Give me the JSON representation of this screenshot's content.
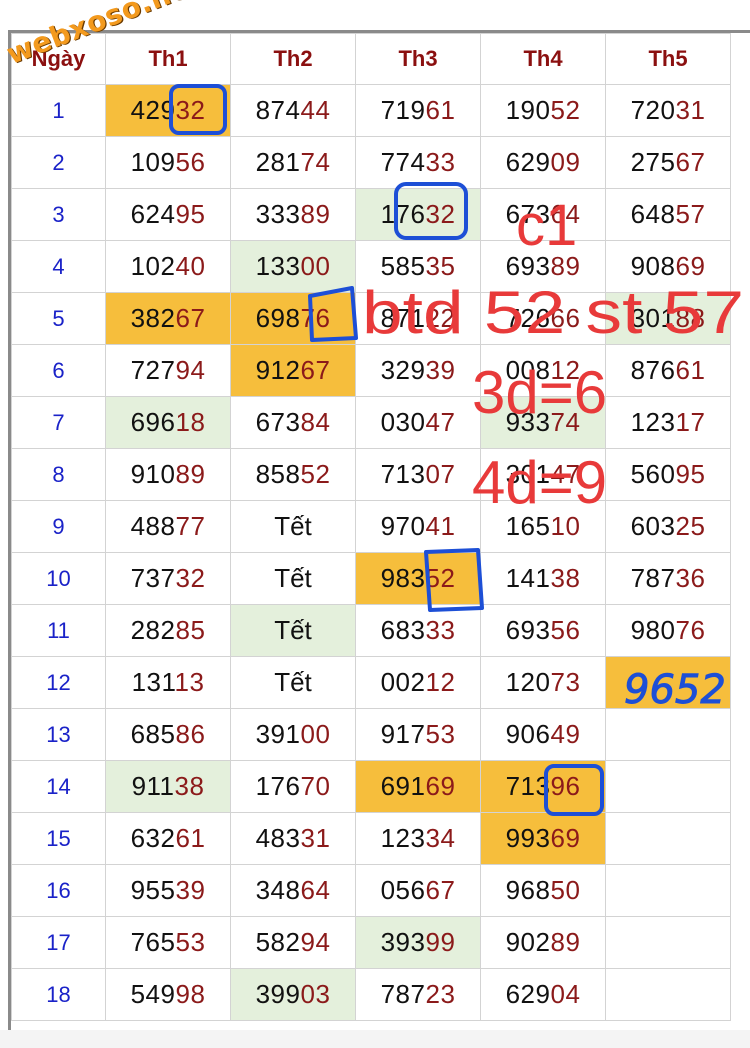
{
  "watermark": "webxoso.net",
  "table": {
    "day_header": "Ngày",
    "headers": [
      "Th1",
      "Th2",
      "Th3",
      "Th4",
      "Th5"
    ],
    "rows": [
      {
        "day": "1",
        "cells": [
          "42932",
          "87444",
          "71961",
          "19052",
          "72031"
        ]
      },
      {
        "day": "2",
        "cells": [
          "10956",
          "28174",
          "77433",
          "62909",
          "27567"
        ]
      },
      {
        "day": "3",
        "cells": [
          "62495",
          "33389",
          "17632",
          "67364",
          "64857"
        ]
      },
      {
        "day": "4",
        "cells": [
          "10240",
          "13300",
          "58535",
          "69389",
          "90869"
        ]
      },
      {
        "day": "5",
        "cells": [
          "38267",
          "69876",
          "87122",
          "72666",
          "30188"
        ]
      },
      {
        "day": "6",
        "cells": [
          "72794",
          "91267",
          "32939",
          "00812",
          "87661"
        ]
      },
      {
        "day": "7",
        "cells": [
          "69618",
          "67384",
          "03047",
          "93374",
          "12317"
        ]
      },
      {
        "day": "8",
        "cells": [
          "91089",
          "85852",
          "71307",
          "30147",
          "56095"
        ]
      },
      {
        "day": "9",
        "cells": [
          "48877",
          "Tết",
          "97041",
          "16510",
          "60325"
        ]
      },
      {
        "day": "10",
        "cells": [
          "73732",
          "Tết",
          "98352",
          "14138",
          "78736"
        ]
      },
      {
        "day": "11",
        "cells": [
          "28285",
          "Tết",
          "68333",
          "69356",
          "98076"
        ]
      },
      {
        "day": "12",
        "cells": [
          "13113",
          "Tết",
          "00212",
          "12073",
          ""
        ]
      },
      {
        "day": "13",
        "cells": [
          "68586",
          "39100",
          "91753",
          "90649",
          ""
        ]
      },
      {
        "day": "14",
        "cells": [
          "91138",
          "17670",
          "69169",
          "71396",
          ""
        ]
      },
      {
        "day": "15",
        "cells": [
          "63261",
          "48331",
          "12334",
          "99369",
          ""
        ]
      },
      {
        "day": "16",
        "cells": [
          "95539",
          "34864",
          "05667",
          "96850",
          ""
        ]
      },
      {
        "day": "17",
        "cells": [
          "76553",
          "58294",
          "39399",
          "90289",
          ""
        ]
      },
      {
        "day": "18",
        "cells": [
          "54998",
          "39903",
          "78723",
          "62904",
          ""
        ]
      }
    ]
  },
  "annotations": {
    "line1": "c1",
    "line2": "btd 52 st 57",
    "line3": "3d=6",
    "line4": "4d=9",
    "handwritten": "9652"
  },
  "colors": {
    "header_text": "#8b1010",
    "day_text": "#1a22c8",
    "highlight_orange": "#f6be3c",
    "highlight_green": "#e4f0dc",
    "annotation_red": "#e83a3a",
    "marker_blue": "#1d4fd6",
    "watermark": "#f39a1e"
  }
}
